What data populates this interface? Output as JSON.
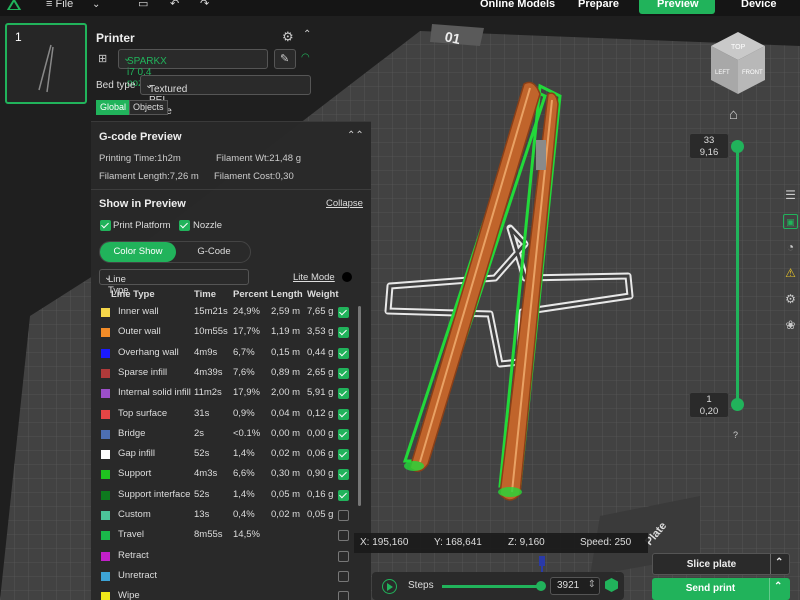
{
  "topbar": {
    "file_label": "File",
    "tabs": [
      {
        "label": "Online Models"
      },
      {
        "label": "Prepare"
      },
      {
        "label": "Preview"
      },
      {
        "label": "Device"
      }
    ]
  },
  "plate": {
    "number": "1",
    "plate_tab_label": "01",
    "corner_label": "Plate"
  },
  "printer": {
    "title": "Printer",
    "model": "SPARKX i7 0.4 nozzle",
    "bed_type_label": "Bed type",
    "bed_type_value": "Textured PEI Plate",
    "segments": [
      "Global",
      "Objects"
    ]
  },
  "gcode_preview": {
    "title": "G-code Preview",
    "printing_time": "Printing Time:1h2m",
    "filament_wt": "Filament Wt:21,48 g",
    "filament_length": "Filament Length:7,26 m",
    "filament_cost": "Filament Cost:0,30",
    "show_title": "Show in Preview",
    "collapse_label": "Collapse",
    "print_platform_label": "Print Platform",
    "nozzle_label": "Nozzle",
    "toggle_color_show": "Color Show",
    "toggle_gcode": "G-Code",
    "line_type_select": "Line Type",
    "lite_mode": "Lite Mode",
    "headers": [
      "Line Type",
      "Time",
      "Percent",
      "Length",
      "Weight"
    ],
    "rows": [
      {
        "name": "Inner wall",
        "color": "#f5d64a",
        "time": "15m21s",
        "percent": "24,9%",
        "length": "2,59 m",
        "weight": "7,65 g",
        "checked": true
      },
      {
        "name": "Outer wall",
        "color": "#f28c28",
        "time": "10m55s",
        "percent": "17,7%",
        "length": "1,19 m",
        "weight": "3,53 g",
        "checked": true
      },
      {
        "name": "Overhang wall",
        "color": "#1a1aff",
        "time": "4m9s",
        "percent": "6,7%",
        "length": "0,15 m",
        "weight": "0,44 g",
        "checked": true
      },
      {
        "name": "Sparse infill",
        "color": "#b03a3a",
        "time": "4m39s",
        "percent": "7,6%",
        "length": "0,89 m",
        "weight": "2,65 g",
        "checked": true
      },
      {
        "name": "Internal solid infill",
        "color": "#9b4fc9",
        "time": "11m2s",
        "percent": "17,9%",
        "length": "2,00 m",
        "weight": "5,91 g",
        "checked": true
      },
      {
        "name": "Top surface",
        "color": "#e64545",
        "time": "31s",
        "percent": "0,9%",
        "length": "0,04 m",
        "weight": "0,12 g",
        "checked": true
      },
      {
        "name": "Bridge",
        "color": "#4d6fb3",
        "time": "2s",
        "percent": "<0.1%",
        "length": "0,00 m",
        "weight": "0,00 g",
        "checked": true
      },
      {
        "name": "Gap infill",
        "color": "#ffffff",
        "time": "52s",
        "percent": "1,4%",
        "length": "0,02 m",
        "weight": "0,06 g",
        "checked": true
      },
      {
        "name": "Support",
        "color": "#1fc21f",
        "time": "4m3s",
        "percent": "6,6%",
        "length": "0,30 m",
        "weight": "0,90 g",
        "checked": true
      },
      {
        "name": "Support interface",
        "color": "#0e7a1e",
        "time": "52s",
        "percent": "1,4%",
        "length": "0,05 m",
        "weight": "0,16 g",
        "checked": true
      },
      {
        "name": "Custom",
        "color": "#4cc49a",
        "time": "13s",
        "percent": "0,4%",
        "length": "0,02 m",
        "weight": "0,05 g",
        "checked": false
      },
      {
        "name": "Travel",
        "color": "#1ab84a",
        "time": "8m55s",
        "percent": "14,5%",
        "length": "",
        "weight": "",
        "checked": false
      },
      {
        "name": "Retract",
        "color": "#c21fc9",
        "time": "",
        "percent": "",
        "length": "",
        "weight": "",
        "checked": false
      },
      {
        "name": "Unretract",
        "color": "#3da3d6",
        "time": "",
        "percent": "",
        "length": "",
        "weight": "",
        "checked": false
      },
      {
        "name": "Wipe",
        "color": "#f0e81a",
        "time": "",
        "percent": "",
        "length": "",
        "weight": "",
        "checked": false
      }
    ]
  },
  "layer_slider": {
    "top_layer": "33",
    "top_height": "9,16",
    "bottom_layer": "1",
    "bottom_height": "0,20",
    "help": "?"
  },
  "view_cube": {
    "top": "TOP",
    "left": "LEFT",
    "front": "FRONT"
  },
  "coords": {
    "x": "X: 195,160",
    "y": "Y: 168,641",
    "z": "Z: 9,160",
    "speed": "Speed: 250"
  },
  "steps": {
    "label": "Steps",
    "value": "3921",
    "position": 1.0
  },
  "actions": {
    "slice": "Slice plate",
    "send": "Send print"
  }
}
